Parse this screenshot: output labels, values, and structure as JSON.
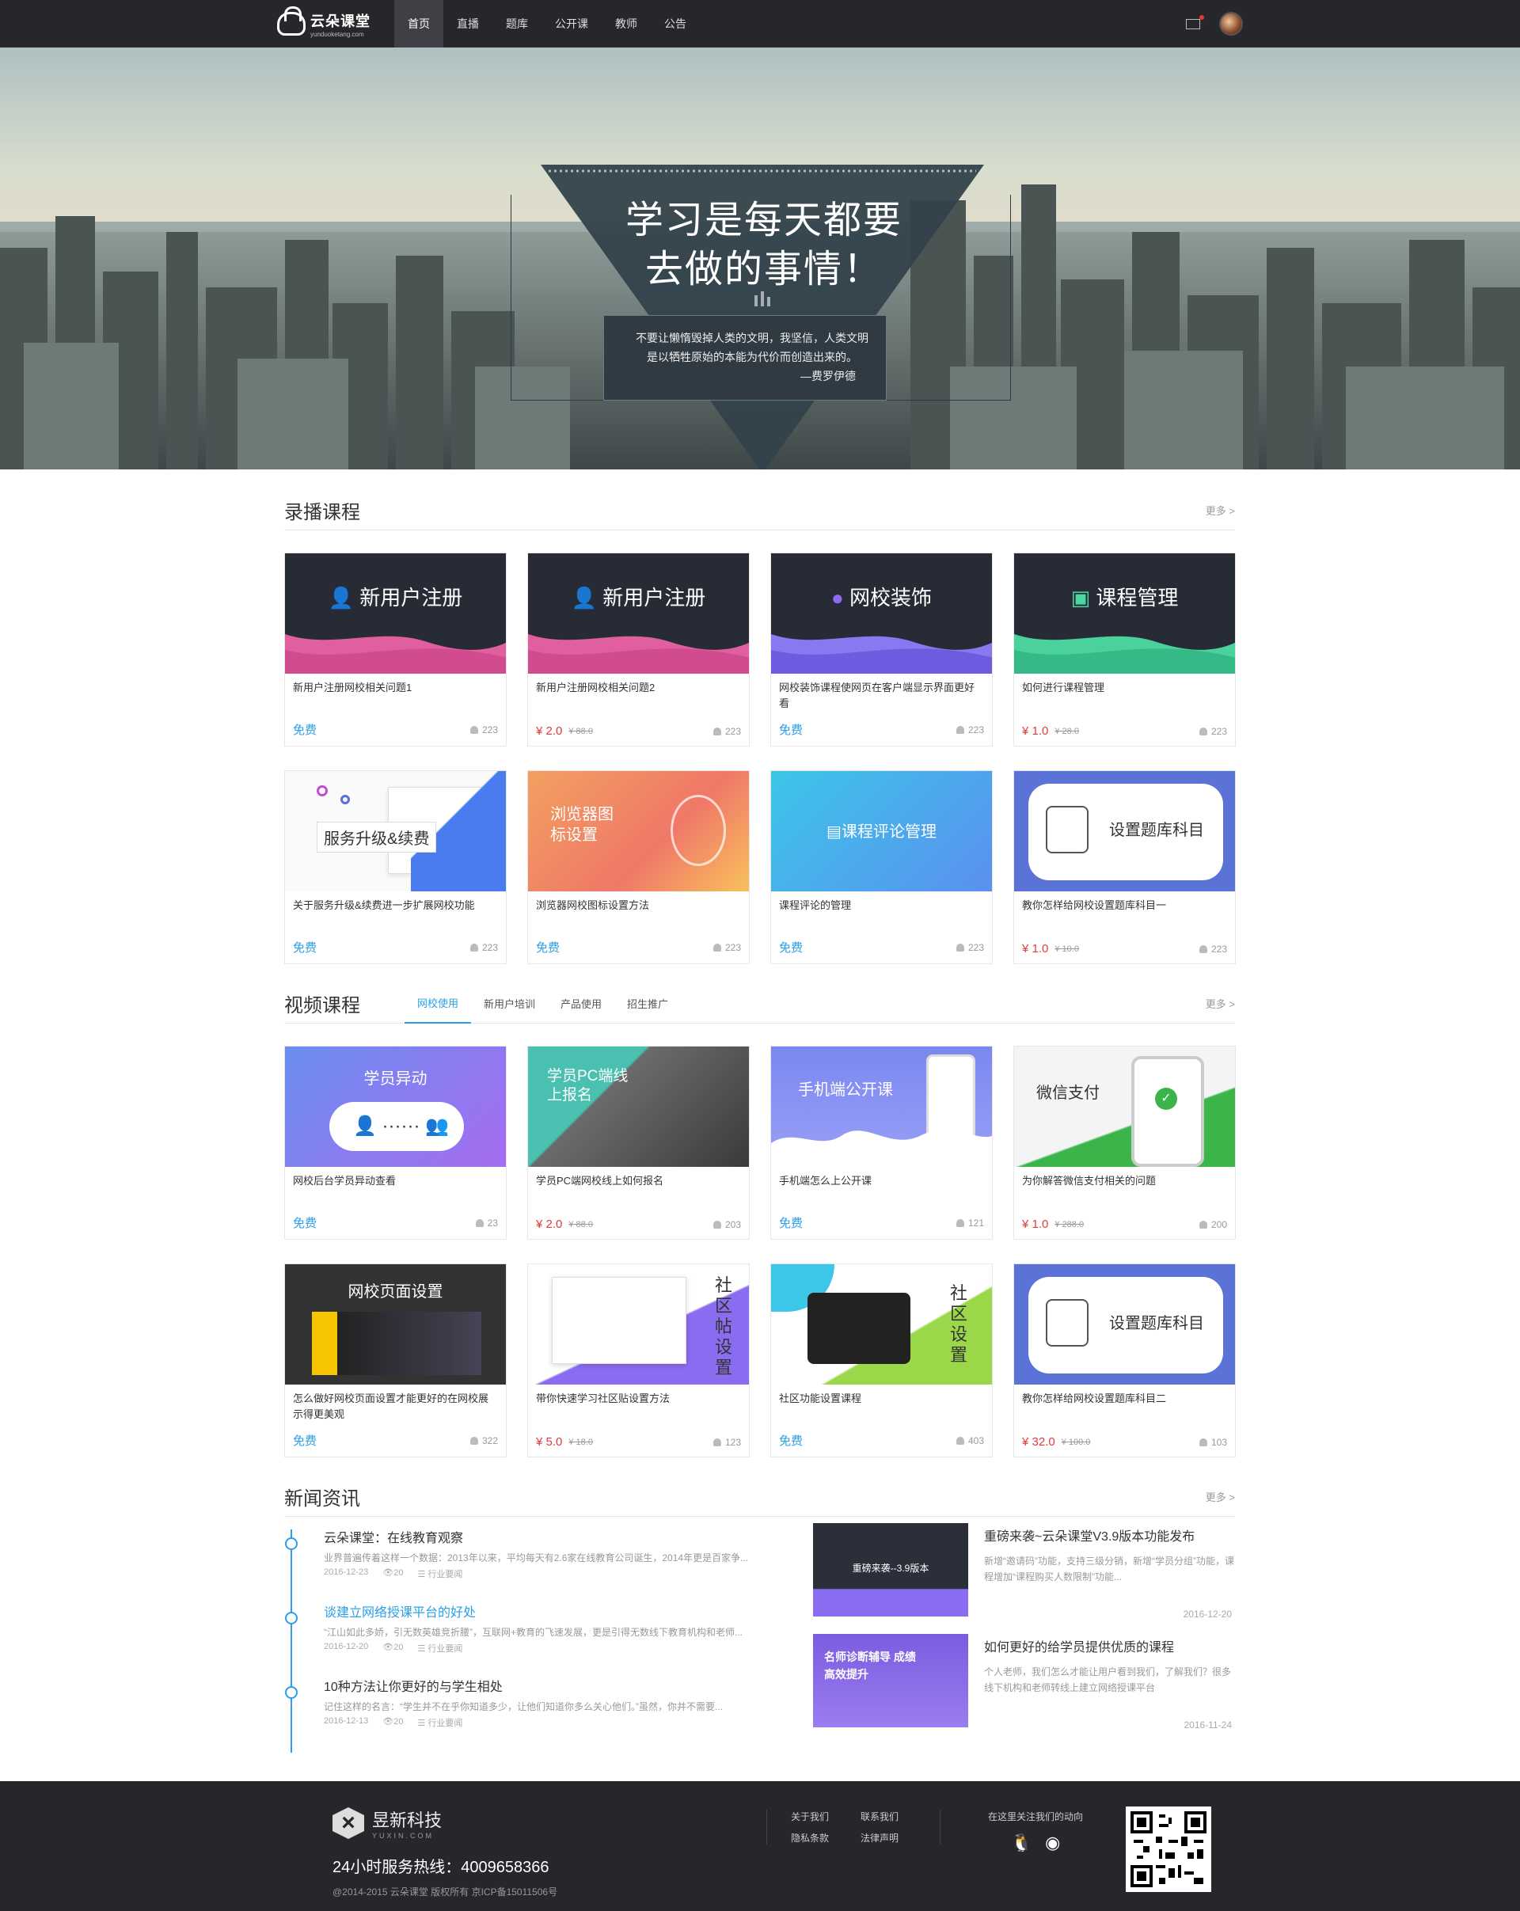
{
  "header": {
    "logo_text": "云朵课堂",
    "logo_sub": "yunduoketang.com",
    "nav": [
      "首页",
      "直播",
      "题库",
      "公开课",
      "教师",
      "公告"
    ]
  },
  "hero": {
    "title_line1": "学习是每天都要",
    "title_line2": "去做的事情！",
    "quote_line1": "不要让懒惰毁掉人类的文明，我坚信，人类文明",
    "quote_line2": "是以牺牲原始的本能为代价而创造出来的。",
    "quote_author": "—费罗伊德"
  },
  "recorded": {
    "title": "录播课程",
    "more": "更多 >",
    "cards": [
      {
        "thumb": "新用户注册",
        "title": "新用户注册网校相关问题1",
        "free": "免费",
        "price": "",
        "oprice": "",
        "count": "223"
      },
      {
        "thumb": "新用户注册",
        "title": "新用户注册网校相关问题2",
        "free": "",
        "price": "¥ 2.0",
        "oprice": "¥ 88.0",
        "count": "223"
      },
      {
        "thumb": "网校装饰",
        "title": "网校装饰课程使网页在客户端显示界面更好看",
        "free": "免费",
        "price": "",
        "oprice": "",
        "count": "223"
      },
      {
        "thumb": "课程管理",
        "title": "如何进行课程管理",
        "free": "",
        "price": "¥ 1.0",
        "oprice": "¥ 28.0",
        "count": "223"
      },
      {
        "thumb": "服务升级&续费",
        "title": "关于服务升级&续费进一步扩展网校功能",
        "free": "免费",
        "price": "",
        "oprice": "",
        "count": "223"
      },
      {
        "thumb": "浏览器图标设置",
        "title": "浏览器网校图标设置方法",
        "free": "免费",
        "price": "",
        "oprice": "",
        "count": "223"
      },
      {
        "thumb": "课程评论管理",
        "title": "课程评论的管理",
        "free": "免费",
        "price": "",
        "oprice": "",
        "count": "223"
      },
      {
        "thumb": "设置题库科目",
        "title": "教你怎样给网校设置题库科目一",
        "free": "",
        "price": "¥ 1.0",
        "oprice": "¥ 10.0",
        "count": "223"
      }
    ]
  },
  "video": {
    "title": "视频课程",
    "more": "更多 >",
    "tabs": [
      "网校使用",
      "新用户培训",
      "产品使用",
      "招生推广"
    ],
    "cards": [
      {
        "thumb": "学员异动",
        "title": "网校后台学员异动查看",
        "free": "免费",
        "price": "",
        "oprice": "",
        "count": "23"
      },
      {
        "thumb": "学员PC端线上报名",
        "title": "学员PC端网校线上如何报名",
        "free": "",
        "price": "¥ 2.0",
        "oprice": "¥ 88.0",
        "count": "203"
      },
      {
        "thumb": "手机端公开课",
        "title": "手机端怎么上公开课",
        "free": "免费",
        "price": "",
        "oprice": "",
        "count": "121"
      },
      {
        "thumb": "微信支付",
        "title": "为你解答微信支付相关的问题",
        "free": "",
        "price": "¥ 1.0",
        "oprice": "¥ 288.0",
        "count": "200"
      },
      {
        "thumb": "网校页面设置",
        "title": "怎么做好网校页面设置才能更好的在网校展示得更美观",
        "free": "免费",
        "price": "",
        "oprice": "",
        "count": "322"
      },
      {
        "thumb": "社区帖设置",
        "title": "带你快速学习社区贴设置方法",
        "free": "",
        "price": "¥ 5.0",
        "oprice": "¥ 18.0",
        "count": "123"
      },
      {
        "thumb": "社区设置",
        "title": "社区功能设置课程",
        "free": "免费",
        "price": "",
        "oprice": "",
        "count": "403"
      },
      {
        "thumb": "设置题库科目",
        "title": "教你怎样给网校设置题库科目二",
        "free": "",
        "price": "¥ 32.0",
        "oprice": "¥ 100.0",
        "count": "103"
      }
    ]
  },
  "news": {
    "title": "新闻资讯",
    "more": "更多 >",
    "items": [
      {
        "title": "云朵课堂：在线教育观察",
        "desc": "业界普遍传着这样一个数据：2013年以来，平均每天有2.6家在线教育公司诞生，2014年更是百家争...",
        "date": "2016-12-23",
        "views": "20",
        "cat": "行业要闻"
      },
      {
        "title": "谈建立网络授课平台的好处",
        "desc": "“江山如此多娇，引无数英雄竞折腰”，互联网+教育的飞速发展，更是引得无数线下教育机构和老师...",
        "date": "2016-12-20",
        "views": "20",
        "cat": "行业要闻"
      },
      {
        "title": "10种方法让你更好的与学生相处",
        "desc": "记住这样的名言：“学生并不在乎你知道多少，让他们知道你多么关心他们。”虽然，你并不需要...",
        "date": "2016-12-13",
        "views": "20",
        "cat": "行业要闻"
      }
    ],
    "features": [
      {
        "pic": "重磅来袭--3.9版本",
        "title": "重磅来袭~云朵课堂V3.9版本功能发布",
        "desc": "新增“邀请码”功能，支持三级分销，新增“学员分组”功能，课程增加“课程购买人数限制”功能...",
        "date": "2016-12-20"
      },
      {
        "pic": "名师诊断辅导 成绩高效提升",
        "title": "如何更好的给学员提供优质的课程",
        "desc": "个人老师，我们怎么才能让用户看到我们，了解我们？很多线下机构和老师转线上建立网络授课平台",
        "date": "2016-11-24"
      }
    ]
  },
  "footer": {
    "brand": "昱新科技",
    "brand_sub": "YUXIN.COM",
    "hotline": "24小时服务热线：4009658366",
    "copyright": "@2014-2015 云朵课堂  版权所有  京ICP备15011506号",
    "links": [
      "关于我们",
      "联系我们",
      "隐私条款",
      "法律声明"
    ],
    "follow": "在这里关注我们的动向"
  },
  "colors": {
    "accent": "#2a9fe8",
    "price": "#e4393c",
    "dark": "#26272b"
  }
}
